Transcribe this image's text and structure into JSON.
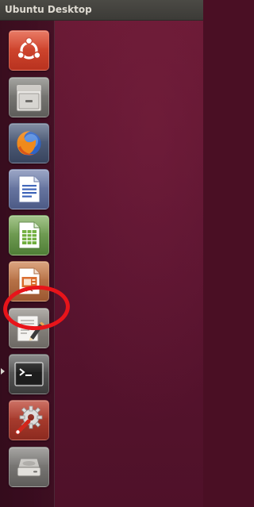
{
  "topbar": {
    "title": "Ubuntu Desktop"
  },
  "launcher": {
    "items": [
      {
        "app": "dash-home",
        "icon": "ubuntu-logo-icon"
      },
      {
        "app": "files",
        "icon": "file-cabinet-icon"
      },
      {
        "app": "firefox",
        "icon": "firefox-icon"
      },
      {
        "app": "libreoffice-writer",
        "icon": "writer-document-icon"
      },
      {
        "app": "libreoffice-calc",
        "icon": "calc-spreadsheet-icon"
      },
      {
        "app": "libreoffice-impress",
        "icon": "impress-presentation-icon"
      },
      {
        "app": "text-editor",
        "icon": "text-editor-pencil-icon",
        "highlighted": true
      },
      {
        "app": "terminal",
        "icon": "terminal-prompt-icon",
        "running": true
      },
      {
        "app": "system-settings",
        "icon": "settings-gear-wrench-icon"
      },
      {
        "app": "drive",
        "icon": "hard-drive-icon"
      }
    ]
  },
  "annotation": {
    "highlight_color": "#e8141a",
    "highlighted_item": "text-editor"
  },
  "colors": {
    "desktop_background": "#5a1430",
    "topbar_background": "#3c3b37",
    "topbar_text": "#dfdbd2"
  }
}
